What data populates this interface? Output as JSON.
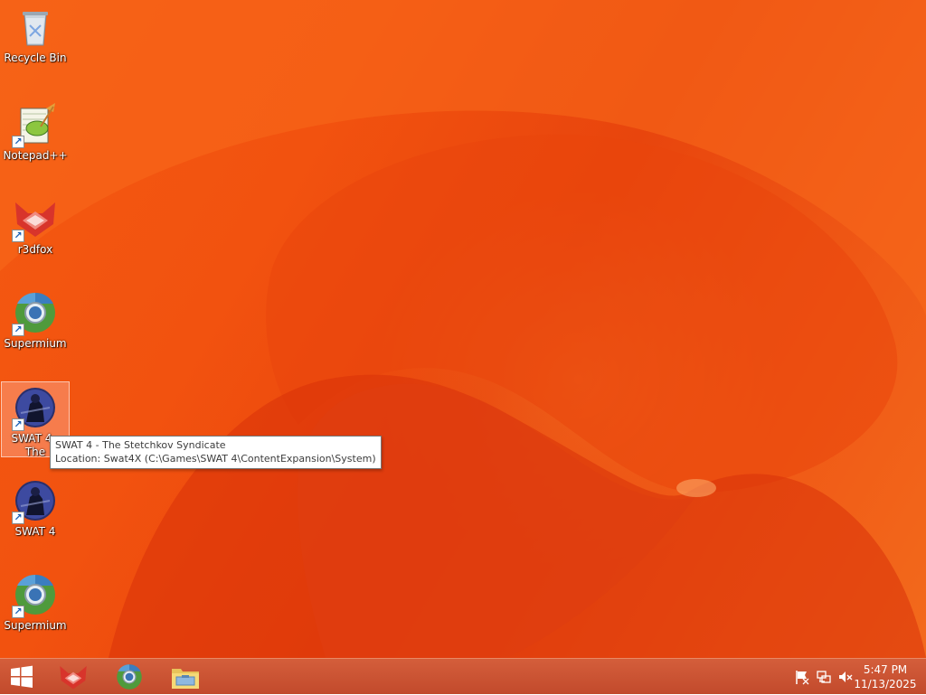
{
  "desktop": {
    "icons": [
      {
        "label": "Recycle Bin",
        "icon": "recycle-bin-icon",
        "shortcut": false
      },
      {
        "label": "Notepad++",
        "icon": "notepadpp-icon",
        "shortcut": true
      },
      {
        "label": "r3dfox",
        "icon": "r3dfox-icon",
        "shortcut": true
      },
      {
        "label": "Supermium",
        "icon": "supermium-icon",
        "shortcut": true
      },
      {
        "label": "SWAT 4 - The Stetchkov ...",
        "icon": "swat4-icon",
        "shortcut": true,
        "selected": true
      },
      {
        "label": "SWAT 4",
        "icon": "swat4-icon",
        "shortcut": true
      },
      {
        "label": "Supermium",
        "icon": "supermium-icon",
        "shortcut": true
      }
    ],
    "tooltip": {
      "line1": "SWAT 4 - The Stetchkov Syndicate",
      "line2": "Location: Swat4X (C:\\Games\\SWAT 4\\ContentExpansion\\System)"
    }
  },
  "taskbar": {
    "start": "windows-start-icon",
    "pinned": [
      "r3dfox-icon",
      "supermium-icon",
      "file-explorer-icon"
    ],
    "tray": [
      "action-center-flag-icon",
      "network-icon",
      "volume-muted-icon"
    ],
    "clock": {
      "time": "5:47 PM",
      "date": "11/13/2025"
    }
  },
  "colors": {
    "wallpaper": "#f2520f",
    "taskbar": "#c9502f",
    "accent": "#ffffff"
  }
}
